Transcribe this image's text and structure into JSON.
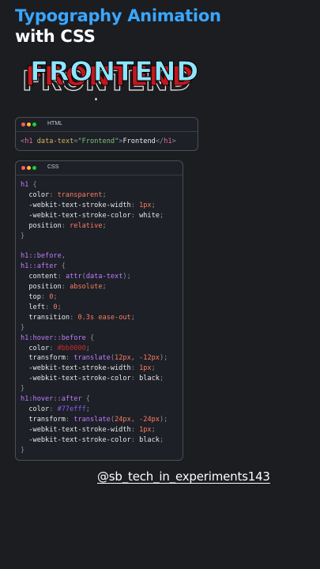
{
  "header": {
    "title_line1": "Typography Animation",
    "title_line2": "with CSS"
  },
  "hero": {
    "text": "FRONTEND",
    "colors": {
      "front": "#8de6ff",
      "shadow": "#c4161c",
      "outline": "#e9e9e9"
    }
  },
  "html_window": {
    "label": "HTML",
    "code": {
      "open_lt": "<",
      "tag": "h1",
      "attr": "data-text",
      "eq": "=",
      "value": "\"Frontend\"",
      "close_gt": ">",
      "text": "Frontend",
      "end_lt": "</",
      "end_tag": "h1",
      "end_gt": ">"
    }
  },
  "css_window": {
    "label": "CSS",
    "lines": [
      [
        {
          "t": "h1",
          "c": "c-sel"
        },
        {
          "t": " {",
          "c": "c-punct"
        }
      ],
      [
        {
          "t": "  color",
          "c": "c-prop"
        },
        {
          "t": ": ",
          "c": "c-punct"
        },
        {
          "t": "transparent",
          "c": "c-val"
        },
        {
          "t": ";",
          "c": "c-punct"
        }
      ],
      [
        {
          "t": "  -webkit-text-stroke-width",
          "c": "c-prop"
        },
        {
          "t": ": ",
          "c": "c-punct"
        },
        {
          "t": "1px",
          "c": "c-val"
        },
        {
          "t": ";",
          "c": "c-punct"
        }
      ],
      [
        {
          "t": "  -webkit-text-stroke-color",
          "c": "c-prop"
        },
        {
          "t": ": ",
          "c": "c-punct"
        },
        {
          "t": "white",
          "c": "c-prop"
        },
        {
          "t": ";",
          "c": "c-punct"
        }
      ],
      [
        {
          "t": "  position",
          "c": "c-prop"
        },
        {
          "t": ": ",
          "c": "c-punct"
        },
        {
          "t": "relative",
          "c": "c-val"
        },
        {
          "t": ";",
          "c": "c-punct"
        }
      ],
      [
        {
          "t": "}",
          "c": "c-punct"
        }
      ],
      [
        {
          "t": "",
          "c": "c-punct"
        }
      ],
      [
        {
          "t": "h1",
          "c": "c-sel"
        },
        {
          "t": "::before",
          "c": "c-sel"
        },
        {
          "t": ",",
          "c": "c-punct"
        }
      ],
      [
        {
          "t": "h1",
          "c": "c-sel"
        },
        {
          "t": "::after",
          "c": "c-sel"
        },
        {
          "t": " {",
          "c": "c-punct"
        }
      ],
      [
        {
          "t": "  content",
          "c": "c-prop"
        },
        {
          "t": ": ",
          "c": "c-punct"
        },
        {
          "t": "attr",
          "c": "c-sel"
        },
        {
          "t": "(",
          "c": "c-punct"
        },
        {
          "t": "data-text",
          "c": "c-sel"
        },
        {
          "t": ");",
          "c": "c-punct"
        }
      ],
      [
        {
          "t": "  position",
          "c": "c-prop"
        },
        {
          "t": ": ",
          "c": "c-punct"
        },
        {
          "t": "absolute",
          "c": "c-val"
        },
        {
          "t": ";",
          "c": "c-punct"
        }
      ],
      [
        {
          "t": "  top",
          "c": "c-prop"
        },
        {
          "t": ": ",
          "c": "c-punct"
        },
        {
          "t": "0",
          "c": "c-val"
        },
        {
          "t": ";",
          "c": "c-punct"
        }
      ],
      [
        {
          "t": "  left",
          "c": "c-prop"
        },
        {
          "t": ": ",
          "c": "c-punct"
        },
        {
          "t": "0",
          "c": "c-val"
        },
        {
          "t": ";",
          "c": "c-punct"
        }
      ],
      [
        {
          "t": "  transition",
          "c": "c-prop"
        },
        {
          "t": ": ",
          "c": "c-punct"
        },
        {
          "t": "0.3s ease-out",
          "c": "c-val"
        },
        {
          "t": ";",
          "c": "c-punct"
        }
      ],
      [
        {
          "t": "}",
          "c": "c-punct"
        }
      ],
      [
        {
          "t": "h1",
          "c": "c-sel"
        },
        {
          "t": ":hover",
          "c": "c-sel"
        },
        {
          "t": "::before",
          "c": "c-sel"
        },
        {
          "t": " {",
          "c": "c-punct"
        }
      ],
      [
        {
          "t": "  color",
          "c": "c-prop"
        },
        {
          "t": ": ",
          "c": "c-punct"
        },
        {
          "t": "#bb0000",
          "c": "c-red"
        },
        {
          "t": ";",
          "c": "c-punct"
        }
      ],
      [
        {
          "t": "  transform",
          "c": "c-prop"
        },
        {
          "t": ": ",
          "c": "c-punct"
        },
        {
          "t": "translate",
          "c": "c-sel"
        },
        {
          "t": "(",
          "c": "c-punct"
        },
        {
          "t": "12px",
          "c": "c-val"
        },
        {
          "t": ", ",
          "c": "c-punct"
        },
        {
          "t": "-12px",
          "c": "c-val"
        },
        {
          "t": ");",
          "c": "c-punct"
        }
      ],
      [
        {
          "t": "  -webkit-text-stroke-width",
          "c": "c-prop"
        },
        {
          "t": ": ",
          "c": "c-punct"
        },
        {
          "t": "1px",
          "c": "c-val"
        },
        {
          "t": ";",
          "c": "c-punct"
        }
      ],
      [
        {
          "t": "  -webkit-text-stroke-color",
          "c": "c-prop"
        },
        {
          "t": ": ",
          "c": "c-punct"
        },
        {
          "t": "black",
          "c": "c-prop"
        },
        {
          "t": ";",
          "c": "c-punct"
        }
      ],
      [
        {
          "t": "}",
          "c": "c-punct"
        }
      ],
      [
        {
          "t": "h1",
          "c": "c-sel"
        },
        {
          "t": ":hover",
          "c": "c-sel"
        },
        {
          "t": "::after",
          "c": "c-sel"
        },
        {
          "t": " {",
          "c": "c-punct"
        }
      ],
      [
        {
          "t": "  color",
          "c": "c-prop"
        },
        {
          "t": ": ",
          "c": "c-punct"
        },
        {
          "t": "#77efff",
          "c": "c-cyan"
        },
        {
          "t": ";",
          "c": "c-punct"
        }
      ],
      [
        {
          "t": "  transform",
          "c": "c-prop"
        },
        {
          "t": ": ",
          "c": "c-punct"
        },
        {
          "t": "translate",
          "c": "c-sel"
        },
        {
          "t": "(",
          "c": "c-punct"
        },
        {
          "t": "24px",
          "c": "c-val"
        },
        {
          "t": ", ",
          "c": "c-punct"
        },
        {
          "t": "-24px",
          "c": "c-val"
        },
        {
          "t": ");",
          "c": "c-punct"
        }
      ],
      [
        {
          "t": "  -webkit-text-stroke-width",
          "c": "c-prop"
        },
        {
          "t": ": ",
          "c": "c-punct"
        },
        {
          "t": "1px",
          "c": "c-val"
        },
        {
          "t": ";",
          "c": "c-punct"
        }
      ],
      [
        {
          "t": "  -webkit-text-stroke-color",
          "c": "c-prop"
        },
        {
          "t": ": ",
          "c": "c-punct"
        },
        {
          "t": "black",
          "c": "c-prop"
        },
        {
          "t": ";",
          "c": "c-punct"
        }
      ],
      [
        {
          "t": "}",
          "c": "c-punct"
        }
      ]
    ]
  },
  "footer": {
    "handle": "@sb_tech_in_experiments143"
  }
}
